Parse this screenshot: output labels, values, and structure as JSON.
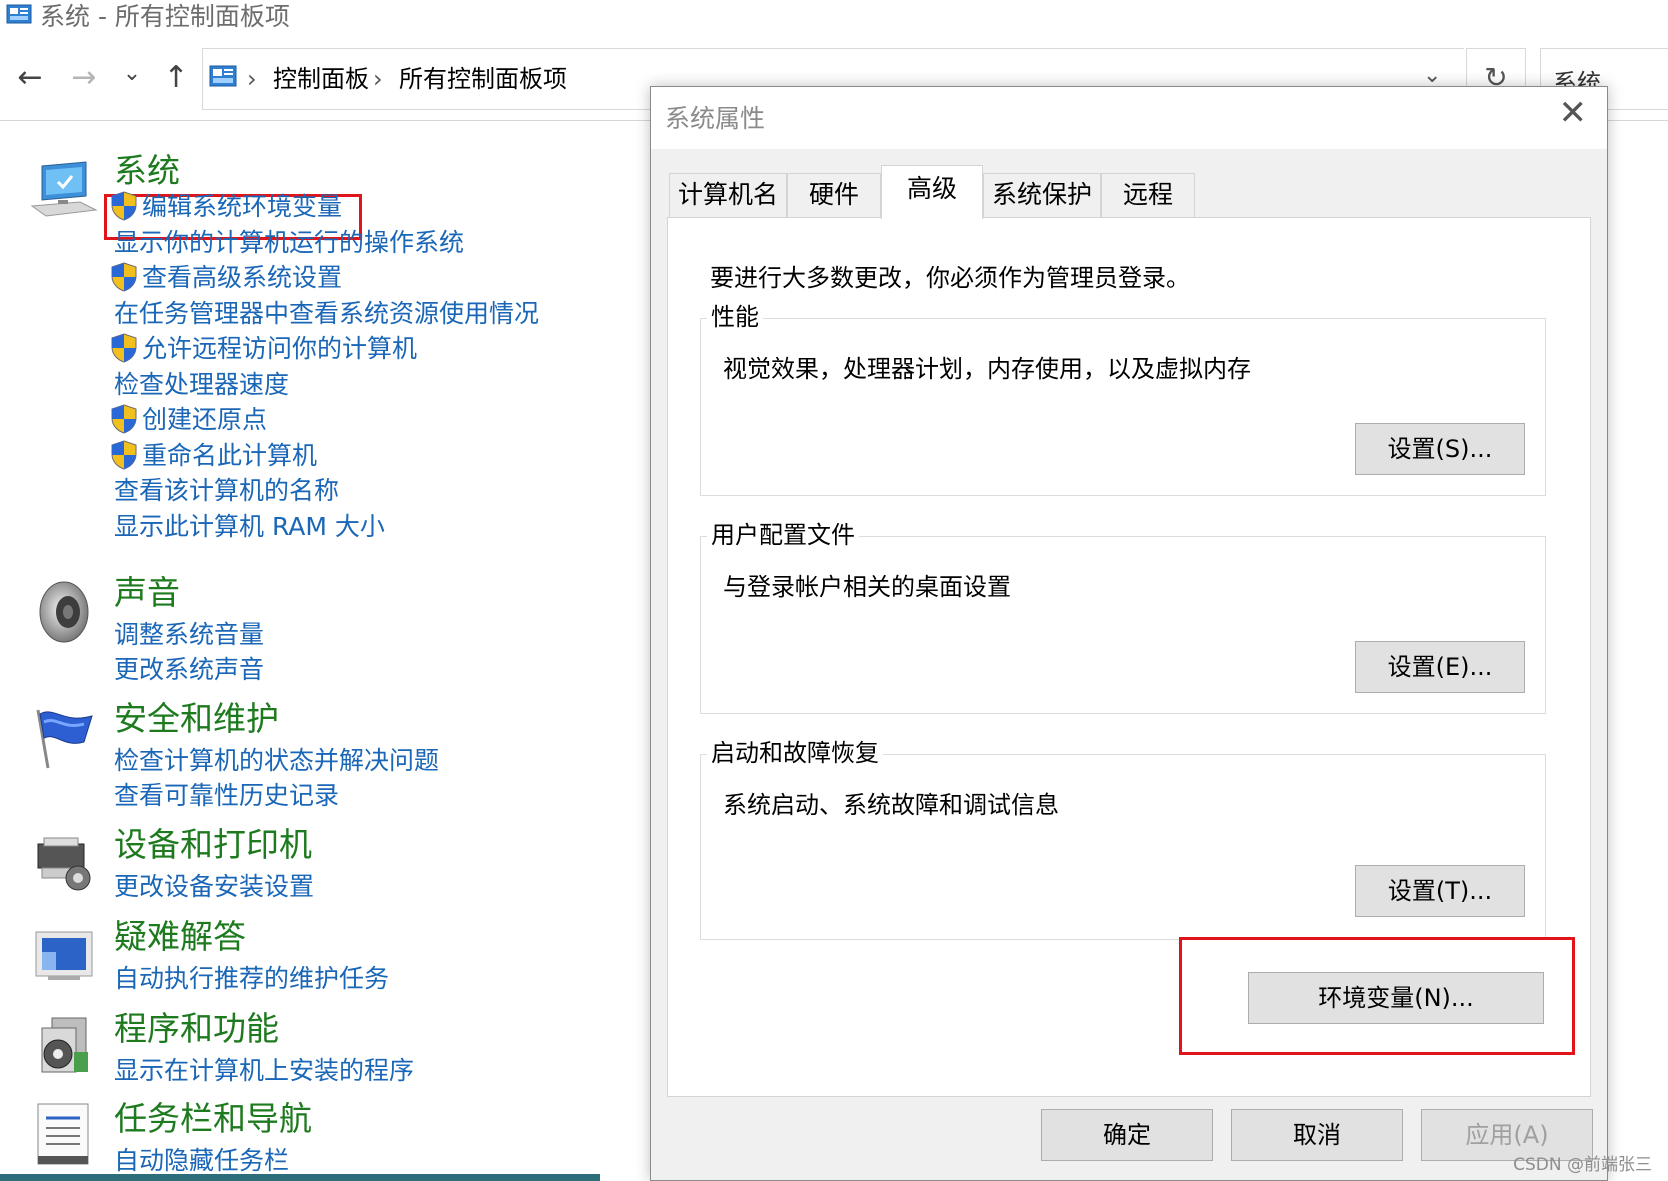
{
  "window": {
    "title": "系统 - 所有控制面板项"
  },
  "nav": {
    "back": "←",
    "forward": "→",
    "recent": "⌄",
    "up": "↑",
    "breadcrumb": [
      "控制面板",
      "所有控制面板项"
    ],
    "separator": "›",
    "dropdown": "⌄",
    "refresh": "↻",
    "search_value": "系统"
  },
  "categories": [
    {
      "heading": "系统",
      "icon": "computer-monitor-icon",
      "links": [
        {
          "label": "编辑系统环境变量",
          "shield": true,
          "highlighted": true
        },
        {
          "label": "显示你的计算机运行的操作系统",
          "shield": false
        },
        {
          "label": "查看高级系统设置",
          "shield": true
        },
        {
          "label": "在任务管理器中查看系统资源使用情况",
          "shield": false
        },
        {
          "label": "允许远程访问你的计算机",
          "shield": true
        },
        {
          "label": "检查处理器速度",
          "shield": false
        },
        {
          "label": "创建还原点",
          "shield": true
        },
        {
          "label": "重命名此计算机",
          "shield": true
        },
        {
          "label": "查看该计算机的名称",
          "shield": false
        },
        {
          "label": "显示此计算机 RAM 大小",
          "shield": false
        }
      ]
    },
    {
      "heading": "声音",
      "icon": "speaker-icon",
      "links": [
        {
          "label": "调整系统音量",
          "shield": false
        },
        {
          "label": "更改系统声音",
          "shield": false
        }
      ]
    },
    {
      "heading": "安全和维护",
      "icon": "flag-icon",
      "links": [
        {
          "label": "检查计算机的状态并解决问题",
          "shield": false
        },
        {
          "label": "查看可靠性历史记录",
          "shield": false
        }
      ]
    },
    {
      "heading": "设备和打印机",
      "icon": "printer-icon",
      "links": [
        {
          "label": "更改设备安装设置",
          "shield": false
        }
      ]
    },
    {
      "heading": "疑难解答",
      "icon": "troubleshoot-icon",
      "links": [
        {
          "label": "自动执行推荐的维护任务",
          "shield": false
        }
      ]
    },
    {
      "heading": "程序和功能",
      "icon": "programs-icon",
      "links": [
        {
          "label": "显示在计算机上安装的程序",
          "shield": false
        }
      ]
    },
    {
      "heading": "任务栏和导航",
      "icon": "taskbar-icon",
      "links": [
        {
          "label": "自动隐藏任务栏",
          "shield": false
        }
      ]
    }
  ],
  "dialog": {
    "title": "系统属性",
    "close": "✕",
    "tabs": [
      "计算机名",
      "硬件",
      "高级",
      "系统保护",
      "远程"
    ],
    "active_tab": "高级",
    "admin_notice": "要进行大多数更改，你必须作为管理员登录。",
    "groups": [
      {
        "legend": "性能",
        "description": "视觉效果，处理器计划，内存使用，以及虚拟内存",
        "button": "设置(S)..."
      },
      {
        "legend": "用户配置文件",
        "description": "与登录帐户相关的桌面设置",
        "button": "设置(E)..."
      },
      {
        "legend": "启动和故障恢复",
        "description": "系统启动、系统故障和调试信息",
        "button": "设置(T)..."
      }
    ],
    "env_button": "环境变量(N)...",
    "ok": "确定",
    "cancel": "取消",
    "apply": "应用(A)"
  },
  "watermark": "CSDN @前端张三",
  "colors": {
    "heading_green": "#1e7a1e",
    "link_blue": "#1a66b7",
    "highlight_red": "#e0151b"
  }
}
